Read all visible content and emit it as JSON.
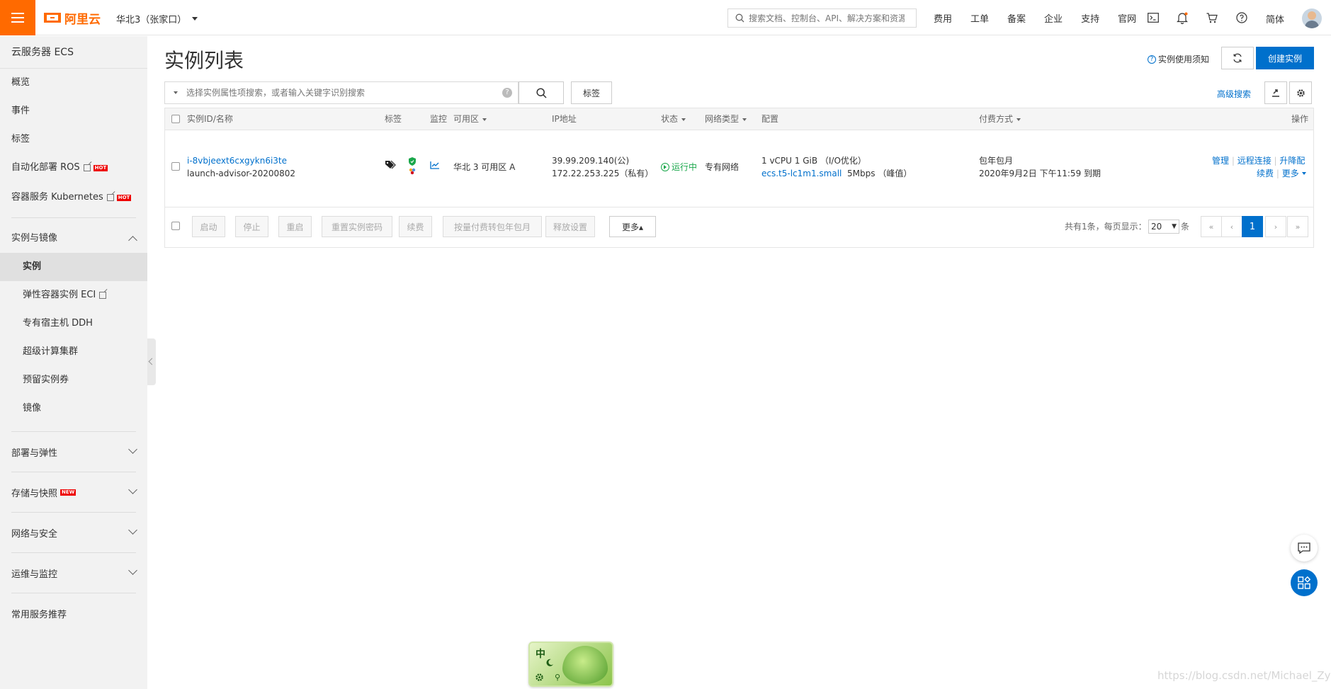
{
  "topbar": {
    "logo_text": "阿里云",
    "region": "华北3（张家口）",
    "search_placeholder": "搜索文档、控制台、API、解决方案和资源",
    "nav": [
      "费用",
      "工单",
      "备案",
      "企业",
      "支持",
      "官网"
    ],
    "lang": "简体"
  },
  "sidebar": {
    "title": "云服务器 ECS",
    "top_items": [
      "概览",
      "事件",
      "标签"
    ],
    "ros_label": "自动化部署 ROS",
    "k8s_label": "容器服务 Kubernetes",
    "hot_badge": "HOT",
    "new_badge": "NEW",
    "group_instances": "实例与镜像",
    "sub_items": [
      "实例",
      "弹性容器实例 ECI",
      "专有宿主机 DDH",
      "超级计算集群",
      "预留实例券",
      "镜像"
    ],
    "groups": [
      "部署与弹性",
      "存储与快照",
      "网络与安全",
      "运维与监控"
    ],
    "recommend": "常用服务推荐"
  },
  "main": {
    "title": "实例列表",
    "notice": "实例使用须知",
    "create_btn": "创建实例",
    "search_placeholder": "选择实例属性项搜索，或者输入关键字识别搜索",
    "tag_btn": "标签",
    "adv_search": "高级搜索",
    "columns": {
      "id_name": "实例ID/名称",
      "tag": "标签",
      "monitor": "监控",
      "zone": "可用区",
      "ip": "IP地址",
      "status": "状态",
      "network": "网络类型",
      "config": "配置",
      "billing": "付费方式",
      "ops": "操作"
    },
    "row": {
      "id": "i-8vbjeext6cxgykn6i3te",
      "name": "launch-advisor-20200802",
      "zone": "华北 3 可用区 A",
      "ip_public": "39.99.209.140(公)",
      "ip_private": "172.22.253.225（私有）",
      "status": "运行中",
      "network": "专有网络",
      "config_line1": "1 vCPU 1 GiB （I/O优化）",
      "instance_type": "ecs.t5-lc1m1.small",
      "bandwidth": "5Mbps （峰值）",
      "billing_type": "包年包月",
      "expire": "2020年9月2日 下午11:59 到期",
      "op_manage": "管理",
      "op_remote": "远程连接",
      "op_upgrade": "升降配",
      "op_renew": "续费",
      "op_more": "更多"
    },
    "bulk": [
      "启动",
      "停止",
      "重启",
      "重置实例密码",
      "续费",
      "按量付费转包年包月",
      "释放设置"
    ],
    "bulk_more": "更多▴",
    "pager": {
      "total_text": "共有1条，每页显示：",
      "page_size": "20",
      "unit": "条",
      "first": "«",
      "prev": "‹",
      "current": "1",
      "next": "›",
      "last": "»"
    }
  },
  "ime": {
    "label": "中"
  },
  "watermark": "https://blog.csdn.net/Michael_Zyz",
  "colors": {
    "brand": "#ff6a00",
    "primary": "#0070cc",
    "running": "#1aa74b"
  }
}
